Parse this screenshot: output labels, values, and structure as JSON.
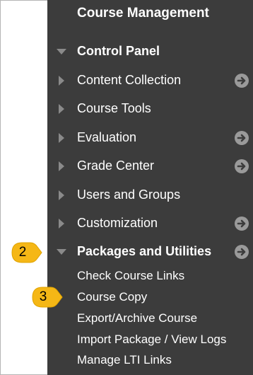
{
  "heading": "Course Management",
  "control_panel": {
    "label": "Control Panel",
    "icon": "triangle-down-icon"
  },
  "menu": [
    {
      "label": "Content Collection",
      "has_arrow": true
    },
    {
      "label": "Course Tools",
      "has_arrow": false
    },
    {
      "label": "Evaluation",
      "has_arrow": true
    },
    {
      "label": "Grade Center",
      "has_arrow": true
    },
    {
      "label": "Users and Groups",
      "has_arrow": false
    },
    {
      "label": "Customization",
      "has_arrow": true
    },
    {
      "label": "Packages and Utilities",
      "has_arrow": true,
      "expanded": true
    }
  ],
  "submenu": [
    "Check Course Links",
    "Course Copy",
    "Export/Archive Course",
    "Import Package / View Logs",
    "Manage LTI Links"
  ],
  "callouts": {
    "step2": "2",
    "step3": "3"
  },
  "colors": {
    "panel_bg": "#3c3c3c",
    "text": "#ffffff",
    "icon_grey": "#9a9a9a",
    "callout_fill": "#f5b716"
  }
}
